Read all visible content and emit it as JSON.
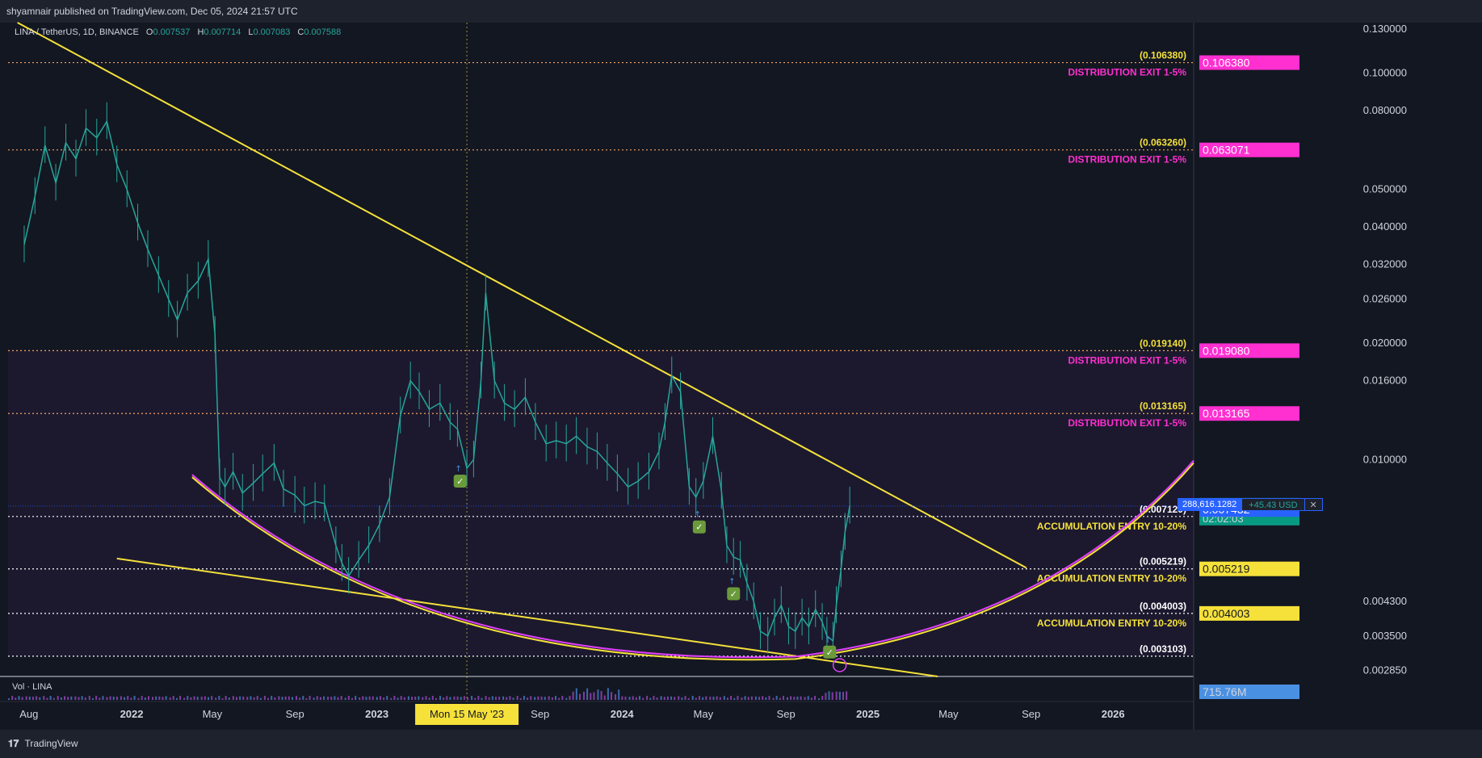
{
  "header": {
    "published": "shyamnair published on TradingView.com, Dec 05, 2024 21:57 UTC"
  },
  "legend": {
    "symbol": "LINA / TetherUS, 1D, BINANCE",
    "open_label": "O",
    "open": "0.007537",
    "high_label": "H",
    "high": "0.007714",
    "low_label": "L",
    "low": "0.007083",
    "close_label": "C",
    "close": "0.007588"
  },
  "volume": {
    "label": "Vol · LINA",
    "value": "715.76M"
  },
  "footer": {
    "brand": "TradingView"
  },
  "crosshair": {
    "date_label": "Mon 15 May '23"
  },
  "position": {
    "qty": "288,616.1282",
    "pnl": "+45.43 USD",
    "close_icon": "close-icon"
  },
  "colors": {
    "background": "#131722",
    "candle": "#26a69a",
    "trendline": "#f5e13a",
    "curve_pink": "#e040fb",
    "distribution": "#ff2fd0",
    "accumulation": "#f5e13a",
    "last_price": "#089981",
    "blue_tag": "#2962ff"
  },
  "chart_data": {
    "type": "line",
    "title": "",
    "scale": "log",
    "x_ticks": [
      "Aug",
      "2022",
      "May",
      "Sep",
      "2023",
      "May",
      "Sep",
      "2024",
      "May",
      "Sep",
      "2025",
      "May",
      "Sep",
      "2026"
    ],
    "y_ticks": [
      "0.130000",
      "0.100000",
      "0.080000",
      "0.050000",
      "0.040000",
      "0.032000",
      "0.026000",
      "0.020000",
      "0.016000",
      "0.010000",
      "0.004300",
      "0.003500",
      "0.002850"
    ],
    "ylim": [
      0.00275,
      0.135
    ],
    "series": [
      {
        "x": [
          "2021-07-25",
          "2021-08-10",
          "2021-08-25",
          "2021-09-10",
          "2021-09-25",
          "2021-10-10",
          "2021-10-25",
          "2021-11-10",
          "2021-11-25",
          "2021-12-10",
          "2021-12-25",
          "2022-01-10",
          "2022-01-25",
          "2022-02-10",
          "2022-02-25",
          "2022-03-10",
          "2022-03-25",
          "2022-04-10",
          "2022-04-25",
          "2022-05-05",
          "2022-05-12",
          "2022-05-20",
          "2022-06-01",
          "2022-06-15",
          "2022-07-01",
          "2022-07-15",
          "2022-08-01",
          "2022-08-15",
          "2022-09-01",
          "2022-09-15",
          "2022-10-01",
          "2022-10-15",
          "2022-11-01",
          "2022-11-10",
          "2022-11-20",
          "2022-12-05",
          "2022-12-20",
          "2023-01-05",
          "2023-01-20",
          "2023-02-05",
          "2023-02-20",
          "2023-03-05",
          "2023-03-20",
          "2023-04-05",
          "2023-04-20",
          "2023-05-01",
          "2023-05-15",
          "2023-05-25",
          "2023-06-05",
          "2023-06-12",
          "2023-06-25",
          "2023-07-10",
          "2023-07-25",
          "2023-08-10",
          "2023-08-25",
          "2023-09-10",
          "2023-09-25",
          "2023-10-10",
          "2023-10-25",
          "2023-11-10",
          "2023-11-25",
          "2023-12-10",
          "2023-12-25",
          "2024-01-10",
          "2024-01-25",
          "2024-02-10",
          "2024-02-25",
          "2024-03-05",
          "2024-03-15",
          "2024-03-28",
          "2024-04-10",
          "2024-04-20",
          "2024-05-01",
          "2024-05-15",
          "2024-05-28",
          "2024-06-05",
          "2024-06-15",
          "2024-06-25",
          "2024-07-05",
          "2024-07-15",
          "2024-07-25",
          "2024-08-05",
          "2024-08-15",
          "2024-08-25",
          "2024-09-05",
          "2024-09-15",
          "2024-09-25",
          "2024-10-05",
          "2024-10-15",
          "2024-10-25",
          "2024-11-01",
          "2024-11-10",
          "2024-11-15",
          "2024-11-22",
          "2024-11-28",
          "2024-12-05"
        ],
        "y": [
          0.036,
          0.048,
          0.065,
          0.052,
          0.066,
          0.06,
          0.072,
          0.068,
          0.075,
          0.058,
          0.05,
          0.041,
          0.035,
          0.03,
          0.026,
          0.023,
          0.027,
          0.029,
          0.033,
          0.021,
          0.009,
          0.0085,
          0.0093,
          0.0082,
          0.0087,
          0.0092,
          0.0098,
          0.0084,
          0.0081,
          0.0076,
          0.0078,
          0.0077,
          0.006,
          0.0054,
          0.005,
          0.0055,
          0.006,
          0.0068,
          0.008,
          0.013,
          0.016,
          0.015,
          0.0135,
          0.014,
          0.0125,
          0.012,
          0.0095,
          0.01,
          0.016,
          0.027,
          0.016,
          0.014,
          0.0135,
          0.0145,
          0.0125,
          0.011,
          0.0112,
          0.011,
          0.0115,
          0.0108,
          0.0105,
          0.0098,
          0.0092,
          0.0085,
          0.0088,
          0.0093,
          0.0105,
          0.0125,
          0.0165,
          0.015,
          0.0085,
          0.008,
          0.0088,
          0.0115,
          0.0083,
          0.006,
          0.0056,
          0.0055,
          0.0048,
          0.0043,
          0.0036,
          0.0035,
          0.0039,
          0.0042,
          0.0037,
          0.0036,
          0.0039,
          0.0037,
          0.0041,
          0.0038,
          0.0035,
          0.0034,
          0.0042,
          0.0052,
          0.0065,
          0.0076
        ]
      }
    ],
    "levels": [
      {
        "value": 0.10638,
        "label": "(0.106380)",
        "tag": "0.106380",
        "note": "DISTRIBUTION EXIT 1-5%",
        "kind": "distribution"
      },
      {
        "value": 0.06326,
        "label": "(0.063260)",
        "tag": "0.063071",
        "note": "DISTRIBUTION EXIT 1-5%",
        "kind": "distribution"
      },
      {
        "value": 0.01914,
        "label": "(0.019140)",
        "tag": "0.019080",
        "note": "DISTRIBUTION EXIT 1-5%",
        "kind": "distribution"
      },
      {
        "value": 0.013165,
        "label": "(0.013165)",
        "tag": "0.013165",
        "note": "DISTRIBUTION EXIT 1-5%",
        "kind": "distribution"
      },
      {
        "value": 0.007129,
        "label": "(0.007129)",
        "tag": "0.007129",
        "note": "ACCUMULATION ENTRY 10-20%",
        "kind": "accumulation"
      },
      {
        "value": 0.005219,
        "label": "(0.005219)",
        "tag": "0.005219",
        "note": "ACCUMULATION ENTRY 10-20%",
        "kind": "accumulation"
      },
      {
        "value": 0.004003,
        "label": "(0.004003)",
        "tag": "0.004003",
        "note": "ACCUMULATION ENTRY 10-20%",
        "kind": "accumulation"
      },
      {
        "value": 0.003103,
        "label": "(0.003103)",
        "tag": "",
        "note": "",
        "kind": "base"
      }
    ],
    "last_price": {
      "value": 0.007588,
      "tag": "0.007588",
      "countdown": "02:02:03"
    },
    "position_price": {
      "value": 0.007432,
      "tag": "0.007432"
    },
    "trendlines": [
      {
        "from": [
          "2021-07-15",
          0.135
        ],
        "to": [
          "2025-08-25",
          0.00525
        ]
      },
      {
        "from": [
          "2021-12-10",
          0.00555
        ],
        "to": [
          "2025-04-15",
          0.00275
        ]
      }
    ],
    "buy_signals": [
      {
        "x": "2023-05-05",
        "y": 0.0088
      },
      {
        "x": "2024-04-25",
        "y": 0.0067
      },
      {
        "x": "2024-06-15",
        "y": 0.0045
      },
      {
        "x": "2024-11-05",
        "y": 0.00318
      }
    ],
    "crosshair_x": "2023-05-15"
  }
}
